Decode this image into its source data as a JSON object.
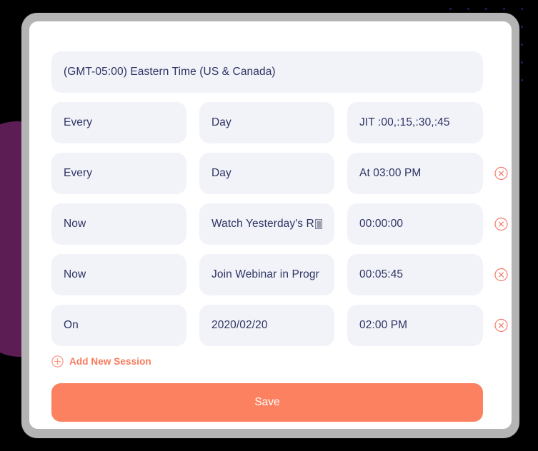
{
  "colors": {
    "background": "#000000",
    "dot_grid": "#1b1b5e",
    "blob": "#5c1c54",
    "frame": "#b4b4b4",
    "card": "#ffffff",
    "field": "#f1f3f9",
    "field_text": "#2e3362",
    "accent": "#fb8160",
    "accent_link": "#f97a5c",
    "delete_icon": "#f4796b"
  },
  "timezone": {
    "value": "(GMT-05:00) Eastern Time (US & Canada)"
  },
  "sessions": [
    {
      "when": "Every",
      "what": "Day",
      "time": "JIT :00,:15,:30,:45",
      "deletable": false,
      "truncated_glyph": false
    },
    {
      "when": "Every",
      "what": "Day",
      "time": "At 03:00 PM",
      "deletable": true,
      "truncated_glyph": false
    },
    {
      "when": "Now",
      "what": "Watch Yesterday's Re",
      "time": "00:00:00",
      "deletable": true,
      "truncated_glyph": true
    },
    {
      "when": "Now",
      "what": "Join Webinar in Progr",
      "time": "00:05:45",
      "deletable": true,
      "truncated_glyph": false
    },
    {
      "when": "On",
      "what": "2020/02/20",
      "time": "02:00 PM",
      "deletable": true,
      "truncated_glyph": false
    }
  ],
  "add_session": {
    "label": "Add New Session"
  },
  "save": {
    "label": "Save"
  }
}
